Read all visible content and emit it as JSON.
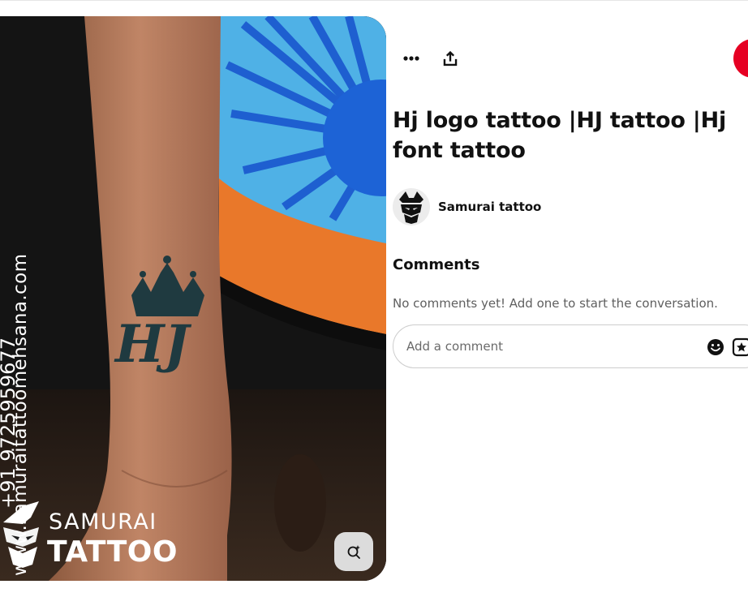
{
  "pin": {
    "title": "Hj logo tattoo |HJ tattoo |Hj font tattoo",
    "image": {
      "tattoo_text": "HJ",
      "watermark_url": "www.samuraitattoomehsana.com",
      "watermark_phone": "+91 9725959677",
      "brand_line1": "SAMURAI",
      "brand_line2": "TATTOO"
    }
  },
  "actions": {
    "more_icon": "ellipsis-icon",
    "share_icon": "share-upload-icon",
    "visual_search_icon": "visual-search-icon"
  },
  "creator": {
    "name": "Samurai tattoo",
    "avatar_icon": "samurai-helmet-icon"
  },
  "comments": {
    "heading": "Comments",
    "empty_text": "No comments yet! Add one to start the conversation.",
    "input_placeholder": "Add a comment",
    "emoji_icon": "emoji-icon",
    "sticker_icon": "sticker-icon"
  },
  "colors": {
    "accent": "#e60023",
    "text": "#111111",
    "muted": "#5f5f5f",
    "border": "#cdcdcd"
  }
}
